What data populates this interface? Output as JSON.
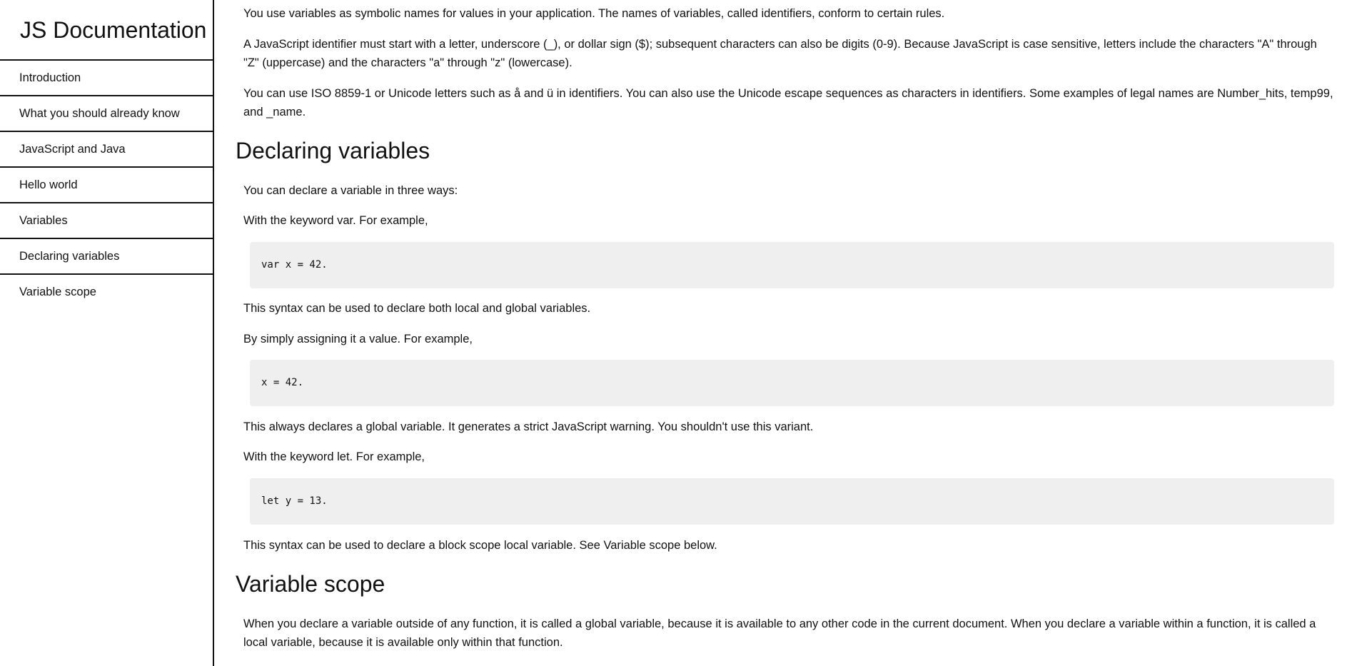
{
  "nav": {
    "title": "JS Documentation",
    "items": [
      "Introduction",
      "What you should already know",
      "JavaScript and Java",
      "Hello world",
      "Variables",
      "Declaring variables",
      "Variable scope"
    ]
  },
  "main": {
    "intro": [
      "You use variables as symbolic names for values in your application. The names of variables, called identifiers, conform to certain rules.",
      "A JavaScript identifier must start with a letter, underscore (_), or dollar sign ($); subsequent characters can also be digits (0-9). Because JavaScript is case sensitive, letters include the characters \"A\" through \"Z\" (uppercase) and the characters \"a\" through \"z\" (lowercase).",
      "You can use ISO 8859-1 or Unicode letters such as å and ü in identifiers. You can also use the Unicode escape sequences as characters in identifiers. Some examples of legal names are Number_hits, temp99, and _name."
    ],
    "declaring": {
      "heading": "Declaring variables",
      "p1": "You can declare a variable in three ways:",
      "p2": "With the keyword var. For example,",
      "code1": "var x = 42.",
      "p3": "This syntax can be used to declare both local and global variables.",
      "p4": "By simply assigning it a value. For example,",
      "code2": "x = 42.",
      "p5": "This always declares a global variable. It generates a strict JavaScript warning. You shouldn't use this variant.",
      "p6": "With the keyword let. For example,",
      "code3": "let y = 13.",
      "p7": "This syntax can be used to declare a block scope local variable. See Variable scope below."
    },
    "scope": {
      "heading": "Variable scope",
      "p1": "When you declare a variable outside of any function, it is called a global variable, because it is available to any other code in the current document. When you declare a variable within a function, it is called a local variable, because it is available only within that function."
    }
  }
}
